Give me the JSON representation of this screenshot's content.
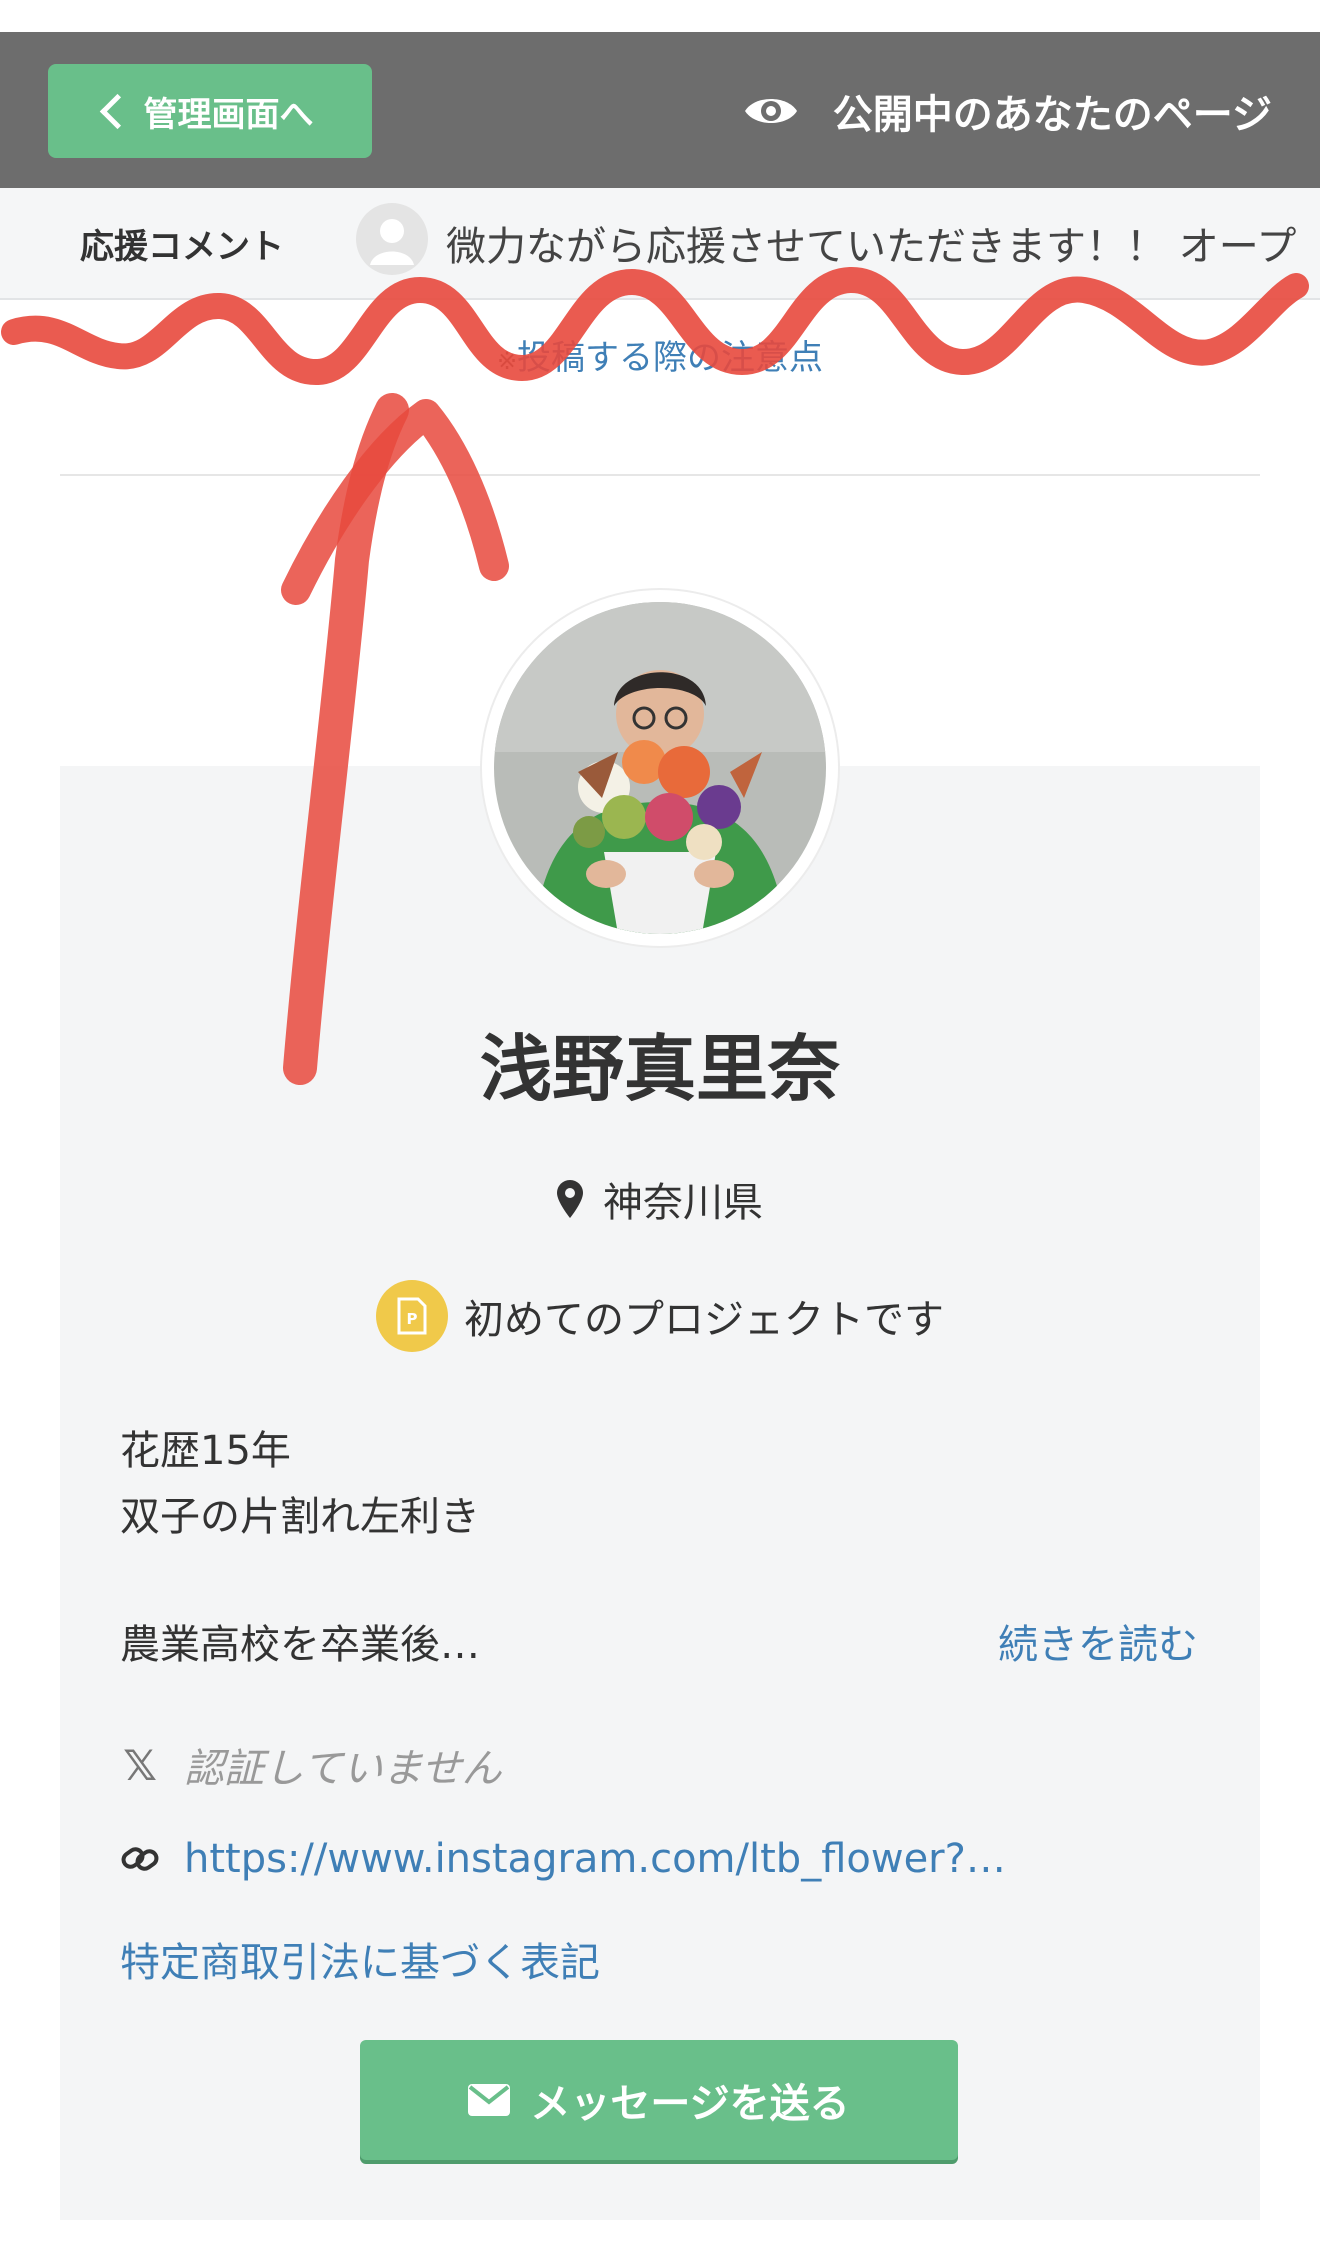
{
  "header": {
    "back_label": "管理画面へ",
    "public_page_label": "公開中のあなたのページ"
  },
  "ticker": {
    "label": "応援コメント",
    "comment": "微力ながら応援させていただきます！！ オープ"
  },
  "notice": {
    "mark": "※",
    "text": "投稿する際の注意点"
  },
  "profile": {
    "name": "浅野真里奈",
    "location": "神奈川県",
    "first_project": "初めてのプロジェクトです",
    "bio_line1": "花歴15年",
    "bio_line2": "双子の片割れ左利き",
    "bio_preview": "農業高校を卒業後…",
    "read_more": "続きを読む",
    "x_status": "認証していません",
    "x_icon_glyph": "𝕏",
    "website": "https://www.instagram.com/ltb_flower?…",
    "law_link": "特定商取引法に基づく表記",
    "message_button": "メッセージを送る"
  },
  "colors": {
    "topbar": "#6d6d6d",
    "green": "#69bf8a",
    "link": "#3f7fb6",
    "card": "#f4f5f6",
    "badge": "#f0c94a",
    "annotation": "#e8493d"
  }
}
